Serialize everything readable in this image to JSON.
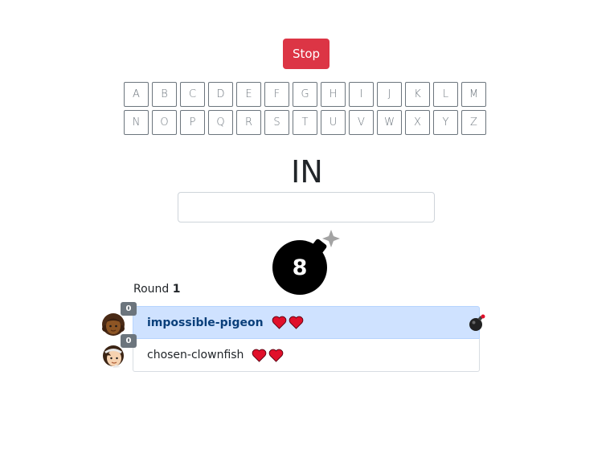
{
  "controls": {
    "stop_label": "Stop"
  },
  "letters": {
    "row1": [
      "A",
      "B",
      "C",
      "D",
      "E",
      "F",
      "G",
      "H",
      "I",
      "J",
      "K",
      "L",
      "M"
    ],
    "row2": [
      "N",
      "O",
      "P",
      "Q",
      "R",
      "S",
      "T",
      "U",
      "V",
      "W",
      "X",
      "Y",
      "Z"
    ]
  },
  "prompt": {
    "syllable": "IN"
  },
  "word_input": {
    "value": "",
    "placeholder": ""
  },
  "bomb": {
    "countdown": "8",
    "icon": "bomb-icon"
  },
  "round": {
    "label": "Round",
    "number": "1"
  },
  "players": [
    {
      "name": "impossible-pigeon",
      "score": "0",
      "lives": 2,
      "active": true,
      "has_bomb": true,
      "avatar": "avatar-girl-braids-icon"
    },
    {
      "name": "chosen-clownfish",
      "score": "0",
      "lives": 2,
      "active": false,
      "has_bomb": false,
      "avatar": "avatar-kid-headband-icon"
    }
  ],
  "colors": {
    "stop": "#dc3545",
    "active_row": "#cfe2ff",
    "active_name": "#0a3f7a",
    "heart": "#e0102a",
    "badge": "#6c757d"
  }
}
